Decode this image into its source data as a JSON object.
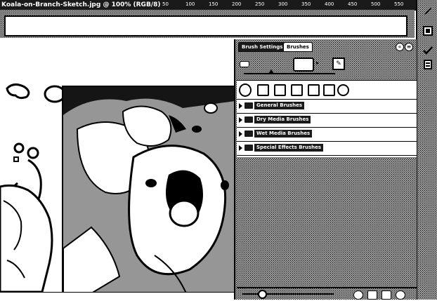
{
  "window": {
    "title": "Koala-on-Branch-Sketch.jpg @ 100% (RGB/8)",
    "ruler_numbers": [
      "50",
      "100",
      "150",
      "200",
      "250",
      "300",
      "350",
      "400",
      "450",
      "500",
      "550"
    ]
  },
  "options_bar": {
    "field_value": ""
  },
  "right_strip": {
    "icons": [
      "brush-icon",
      "layers-icon",
      "history-icon",
      "swatches-icon"
    ]
  },
  "panel": {
    "tabs": [
      {
        "label": "Brush Settings",
        "active": false
      },
      {
        "label": "Brushes",
        "active": true
      }
    ],
    "controls": {
      "collapse": "«",
      "menu": "≡"
    },
    "edit_glyph": "✎",
    "preview_arrow": "▸",
    "brush_tips": [
      "round",
      "square",
      "square",
      "square",
      "square",
      "square",
      "round"
    ],
    "folders": [
      {
        "label": "General Brushes"
      },
      {
        "label": "Dry Media Brushes"
      },
      {
        "label": "Wet Media Brushes"
      },
      {
        "label": "Special Effects Brushes"
      }
    ],
    "bottom_icons": [
      "brush-options-icon",
      "new-group-icon",
      "new-brush-icon",
      "delete-icon"
    ]
  },
  "colors": {
    "dark": "#1a1a1a",
    "light": "#ffffff",
    "stipple": "#c8c8c8"
  }
}
